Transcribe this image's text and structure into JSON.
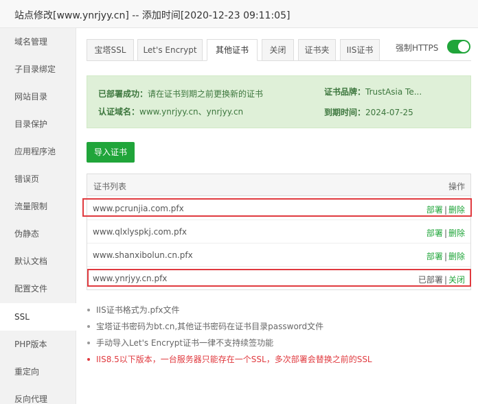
{
  "window": {
    "title": "站点修改[www.ynrjyy.cn] -- 添加时间[2020-12-23 09:11:05]"
  },
  "sidebar": {
    "items": [
      {
        "label": "域名管理"
      },
      {
        "label": "子目录绑定"
      },
      {
        "label": "网站目录"
      },
      {
        "label": "目录保护"
      },
      {
        "label": "应用程序池"
      },
      {
        "label": "错误页"
      },
      {
        "label": "流量限制"
      },
      {
        "label": "伪静态"
      },
      {
        "label": "默认文档"
      },
      {
        "label": "配置文件"
      },
      {
        "label": "SSL",
        "active": true
      },
      {
        "label": "PHP版本"
      },
      {
        "label": "重定向"
      },
      {
        "label": "反向代理"
      }
    ]
  },
  "tabs": [
    {
      "label": "宝塔SSL"
    },
    {
      "label": "Let's Encrypt"
    },
    {
      "label": "其他证书",
      "active": true
    },
    {
      "label": "关闭"
    },
    {
      "label": "证书夹"
    },
    {
      "label": "IIS证书"
    }
  ],
  "force_https": {
    "label": "强制HTTPS",
    "enabled": true,
    "color": "#20a53a"
  },
  "cert_info": {
    "deploy_status_label": "已部署成功：",
    "deploy_status_value": "请在证书到期之前更换新的证书",
    "domain_label": "认证域名：",
    "domain_value": "www.ynrjyy.cn、ynrjyy.cn",
    "brand_label": "证书品牌：",
    "brand_value": "TrustAsia Te...",
    "expire_label": "到期时间：",
    "expire_value": "2024-07-25"
  },
  "import_button": {
    "label": "导入证书"
  },
  "cert_table": {
    "header_name": "证书列表",
    "header_ops": "操作",
    "rows": [
      {
        "name": "www.pcrunjia.com.pfx",
        "op1": "部署",
        "sep": "|",
        "op2": "删除"
      },
      {
        "name": "www.qlxlyspkj.com.pfx",
        "op1": "部署",
        "sep": "|",
        "op2": "删除"
      },
      {
        "name": "www.shanxibolun.cn.pfx",
        "op1": "部署",
        "sep": "|",
        "op2": "删除"
      },
      {
        "name": "www.ynrjyy.cn.pfx",
        "op1": "已部署",
        "sep": "|",
        "op2": "关闭"
      }
    ]
  },
  "notes": [
    {
      "text": "IIS证书格式为.pfx文件"
    },
    {
      "text": "宝塔证书密码为bt.cn,其他证书密码在证书目录password文件"
    },
    {
      "text": "手动导入Let's Encrypt证书一律不支持续签功能"
    },
    {
      "text": "IIS8.5以下版本，一台服务器只能存在一个SSL，多次部署会替换之前的SSL",
      "warning": true
    }
  ],
  "colors": {
    "accent": "#20a53a",
    "highlight": "#e0393e",
    "warning": "#e0393e"
  }
}
